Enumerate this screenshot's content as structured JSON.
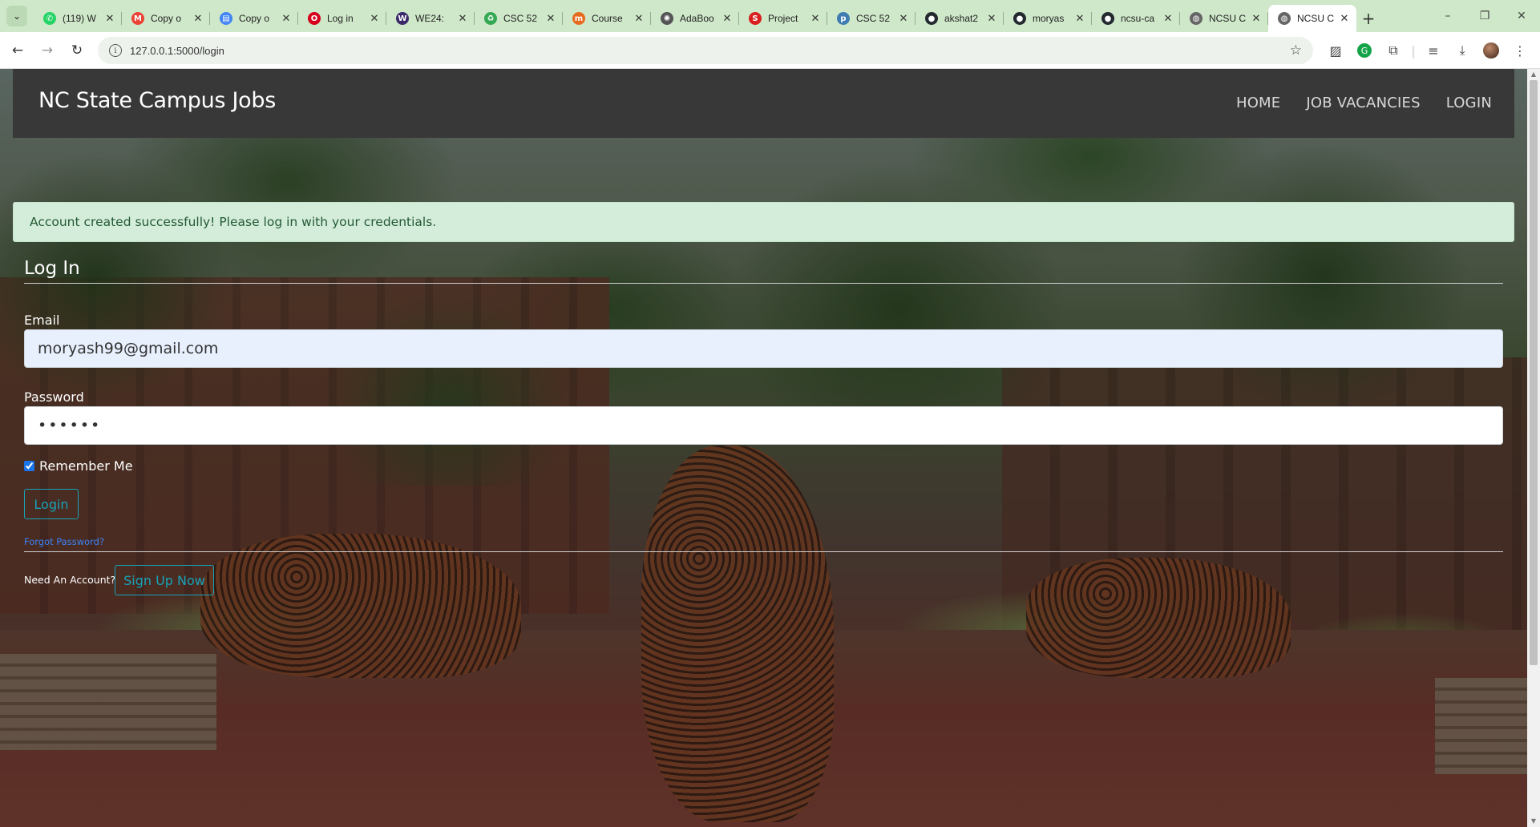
{
  "browser": {
    "tabs": [
      {
        "title": "(119) W",
        "icon": "whatsapp-icon",
        "color": "#25d366",
        "glyph": "✆"
      },
      {
        "title": "Copy o",
        "icon": "gmail-icon",
        "color": "#ea4335",
        "glyph": "M"
      },
      {
        "title": "Copy o",
        "icon": "docs-icon",
        "color": "#4285f4",
        "glyph": "▤"
      },
      {
        "title": "Log in",
        "icon": "opera-icon",
        "color": "#d6001c",
        "glyph": "O"
      },
      {
        "title": "WE24:",
        "icon": "we-icon",
        "color": "#3b2a6b",
        "glyph": "W"
      },
      {
        "title": "CSC 52",
        "icon": "recycle-icon",
        "color": "#34a853",
        "glyph": "♻"
      },
      {
        "title": "Course",
        "icon": "coursera-icon",
        "color": "#e66a1f",
        "glyph": "m"
      },
      {
        "title": "AdaBoo",
        "icon": "chatgpt-icon",
        "color": "#555555",
        "glyph": "✺"
      },
      {
        "title": "Project",
        "icon": "se-icon",
        "color": "#d81e1e",
        "glyph": "S"
      },
      {
        "title": "CSC 52",
        "icon": "piazza-icon",
        "color": "#3e7cb1",
        "glyph": "p"
      },
      {
        "title": "akshat2",
        "icon": "github-icon",
        "color": "#24292f",
        "glyph": "●"
      },
      {
        "title": "moryas",
        "icon": "github-icon",
        "color": "#24292f",
        "glyph": "●"
      },
      {
        "title": "ncsu-ca",
        "icon": "github-icon",
        "color": "#24292f",
        "glyph": "●"
      },
      {
        "title": "NCSU C",
        "icon": "globe-icon",
        "color": "#666666",
        "glyph": "◍"
      },
      {
        "title": "NCSU C",
        "icon": "globe-icon",
        "color": "#666666",
        "glyph": "◍",
        "active": true
      }
    ],
    "url": "127.0.0.1:5000/login"
  },
  "site": {
    "brand": "NC State Campus Jobs",
    "nav": [
      "HOME",
      "JOB VACANCIES",
      "LOGIN"
    ],
    "alert": "Account created successfully! Please log in with your credentials."
  },
  "form": {
    "legend": "Log In",
    "email_label": "Email",
    "email_value": "moryash99@gmail.com",
    "password_label": "Password",
    "password_value": "••••••",
    "remember_label": "Remember Me",
    "remember_checked": true,
    "login_button": "Login",
    "forgot_link": "Forgot Password?",
    "need_account": "Need An Account?",
    "signup_button": "Sign Up Now"
  },
  "colors": {
    "navbar": "#383838",
    "alert_bg": "#d4eddb",
    "alert_text": "#245a34",
    "outline_button": "#17a2b8",
    "tabbar": "#cfe8c9"
  }
}
